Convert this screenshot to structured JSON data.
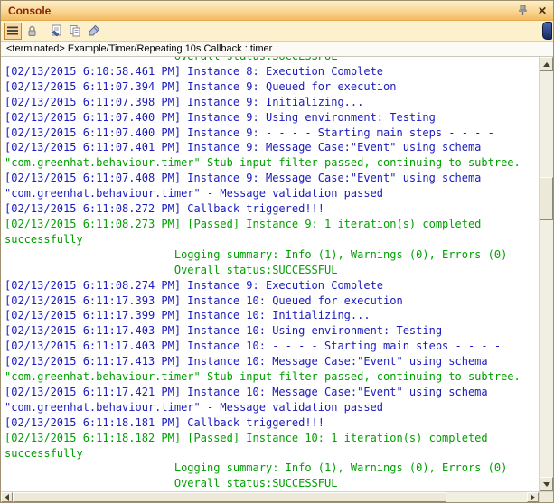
{
  "titlebar": {
    "title": "Console"
  },
  "toolbar": {
    "buttons": [
      {
        "name": "view-menu",
        "pressed": true
      },
      {
        "name": "lock-console",
        "pressed": false
      },
      {
        "name": "export-log",
        "pressed": false
      },
      {
        "name": "copy",
        "pressed": false
      },
      {
        "name": "clear-console",
        "pressed": false
      }
    ]
  },
  "status_line": "<terminated> Example/Timer/Repeating 10s Callback : timer",
  "colors": {
    "log_blue": "#1b1bbe",
    "log_green": "#00a000",
    "title_text": "#8a2500"
  },
  "console": {
    "lines": [
      {
        "text": "                          Overall status:SUCCESSFUL",
        "color": "green"
      },
      {
        "text": "[02/13/2015 6:10:58.461 PM] Instance 8: Execution Complete",
        "color": "blue"
      },
      {
        "text": "[02/13/2015 6:11:07.394 PM] Instance 9: Queued for execution",
        "color": "blue"
      },
      {
        "text": "[02/13/2015 6:11:07.398 PM] Instance 9: Initializing...",
        "color": "blue"
      },
      {
        "text": "[02/13/2015 6:11:07.400 PM] Instance 9: Using environment: Testing",
        "color": "blue"
      },
      {
        "text": "[02/13/2015 6:11:07.400 PM] Instance 9: - - - - Starting main steps - - - -",
        "color": "blue"
      },
      {
        "text": "[02/13/2015 6:11:07.401 PM] Instance 9: Message Case:\"Event\" using schema",
        "color": "blue"
      },
      {
        "text": "\"com.greenhat.behaviour.timer\" Stub input filter passed, continuing to subtree.",
        "color": "green"
      },
      {
        "text": "[02/13/2015 6:11:07.408 PM] Instance 9: Message Case:\"Event\" using schema",
        "color": "blue"
      },
      {
        "text": "\"com.greenhat.behaviour.timer\" - Message validation passed",
        "color": "blue"
      },
      {
        "text": "[02/13/2015 6:11:08.272 PM] Callback triggered!!!",
        "color": "blue"
      },
      {
        "text": "[02/13/2015 6:11:08.273 PM] [Passed] Instance 9: 1 iteration(s) completed",
        "color": "green"
      },
      {
        "text": "successfully",
        "color": "green"
      },
      {
        "text": "                          Logging summary: Info (1), Warnings (0), Errors (0)",
        "color": "green"
      },
      {
        "text": "                          Overall status:SUCCESSFUL",
        "color": "green"
      },
      {
        "text": "[02/13/2015 6:11:08.274 PM] Instance 9: Execution Complete",
        "color": "blue"
      },
      {
        "text": "[02/13/2015 6:11:17.393 PM] Instance 10: Queued for execution",
        "color": "blue"
      },
      {
        "text": "[02/13/2015 6:11:17.399 PM] Instance 10: Initializing...",
        "color": "blue"
      },
      {
        "text": "[02/13/2015 6:11:17.403 PM] Instance 10: Using environment: Testing",
        "color": "blue"
      },
      {
        "text": "[02/13/2015 6:11:17.403 PM] Instance 10: - - - - Starting main steps - - - -",
        "color": "blue"
      },
      {
        "text": "[02/13/2015 6:11:17.413 PM] Instance 10: Message Case:\"Event\" using schema",
        "color": "blue"
      },
      {
        "text": "\"com.greenhat.behaviour.timer\" Stub input filter passed, continuing to subtree.",
        "color": "green"
      },
      {
        "text": "[02/13/2015 6:11:17.421 PM] Instance 10: Message Case:\"Event\" using schema",
        "color": "blue"
      },
      {
        "text": "\"com.greenhat.behaviour.timer\" - Message validation passed",
        "color": "blue"
      },
      {
        "text": "[02/13/2015 6:11:18.181 PM] Callback triggered!!!",
        "color": "blue"
      },
      {
        "text": "[02/13/2015 6:11:18.182 PM] [Passed] Instance 10: 1 iteration(s) completed",
        "color": "green"
      },
      {
        "text": "successfully",
        "color": "green"
      },
      {
        "text": "                          Logging summary: Info (1), Warnings (0), Errors (0)",
        "color": "green"
      },
      {
        "text": "                          Overall status:SUCCESSFUL",
        "color": "green"
      }
    ]
  }
}
